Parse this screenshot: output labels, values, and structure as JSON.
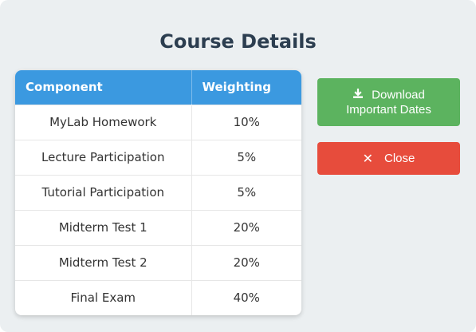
{
  "dialog": {
    "title": "Course Details"
  },
  "table": {
    "headers": {
      "component": "Component",
      "weighting": "Weighting"
    },
    "rows": [
      {
        "component": "MyLab Homework",
        "weighting": "10%"
      },
      {
        "component": "Lecture Participation",
        "weighting": "5%"
      },
      {
        "component": "Tutorial Participation",
        "weighting": "5%"
      },
      {
        "component": "Midterm Test 1",
        "weighting": "20%"
      },
      {
        "component": "Midterm Test 2",
        "weighting": "20%"
      },
      {
        "component": "Final Exam",
        "weighting": "40%"
      }
    ]
  },
  "actions": {
    "download": {
      "line1": "Download",
      "line2": "Important Dates",
      "icon": "download-icon",
      "color": "#5cb35f"
    },
    "close": {
      "label": "Close",
      "icon": "close-icon",
      "color": "#e74c3c"
    }
  },
  "colors": {
    "header_bg": "#3b99e0",
    "title_text": "#2c3e50",
    "panel_bg": "#ebeff1"
  }
}
